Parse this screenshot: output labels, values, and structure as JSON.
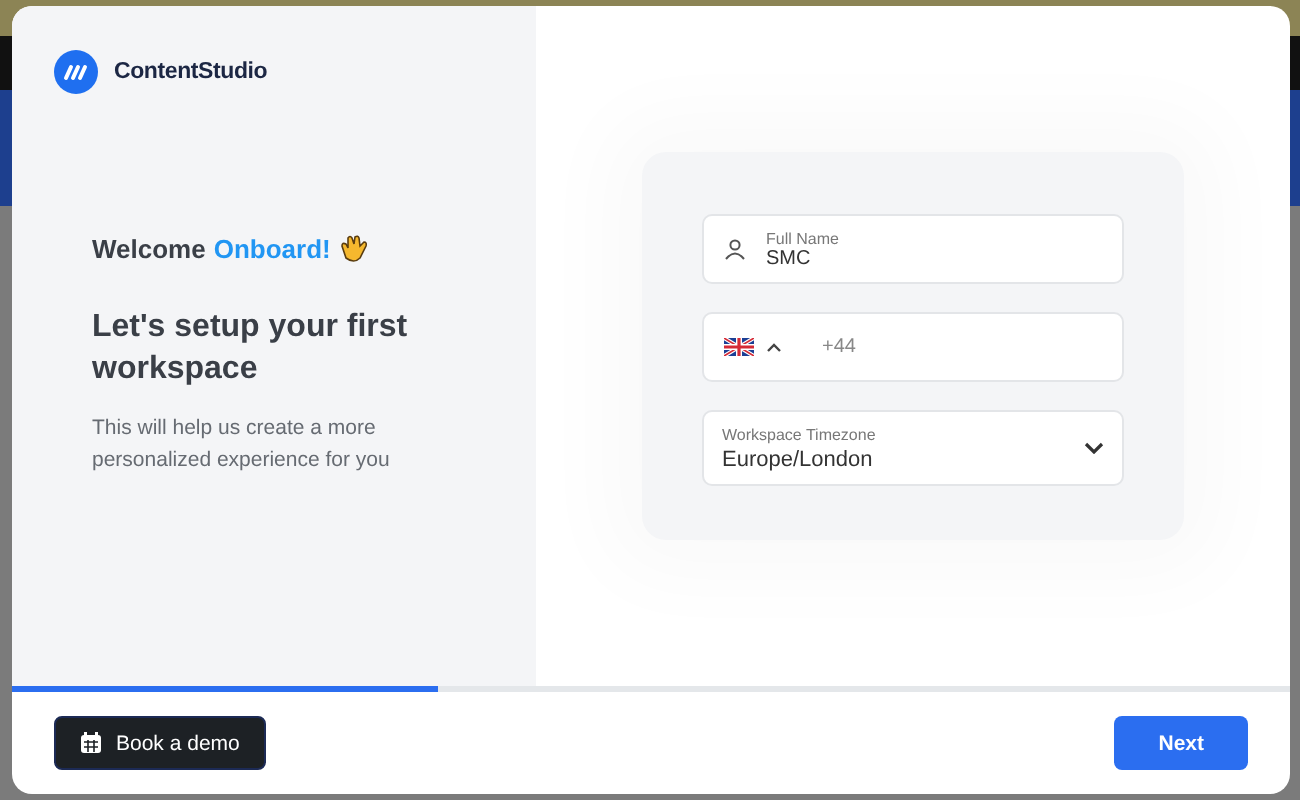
{
  "brand": {
    "name": "ContentStudio"
  },
  "intro": {
    "welcome": "Welcome",
    "welcome_highlight": "Onboard!",
    "title": "Let's setup your first workspace",
    "subtitle": "This will help us create a more personalized experience for you"
  },
  "form": {
    "full_name": {
      "label": "Full Name",
      "value": "SMC"
    },
    "phone": {
      "dial_code": "+44"
    },
    "timezone": {
      "label": "Workspace Timezone",
      "value": "Europe/London"
    }
  },
  "progress": {
    "level": 0.333
  },
  "buttons": [
    {
      "label": "Book a demo",
      "kind": "secondary"
    },
    {
      "label": "Next",
      "kind": "primary"
    }
  ]
}
